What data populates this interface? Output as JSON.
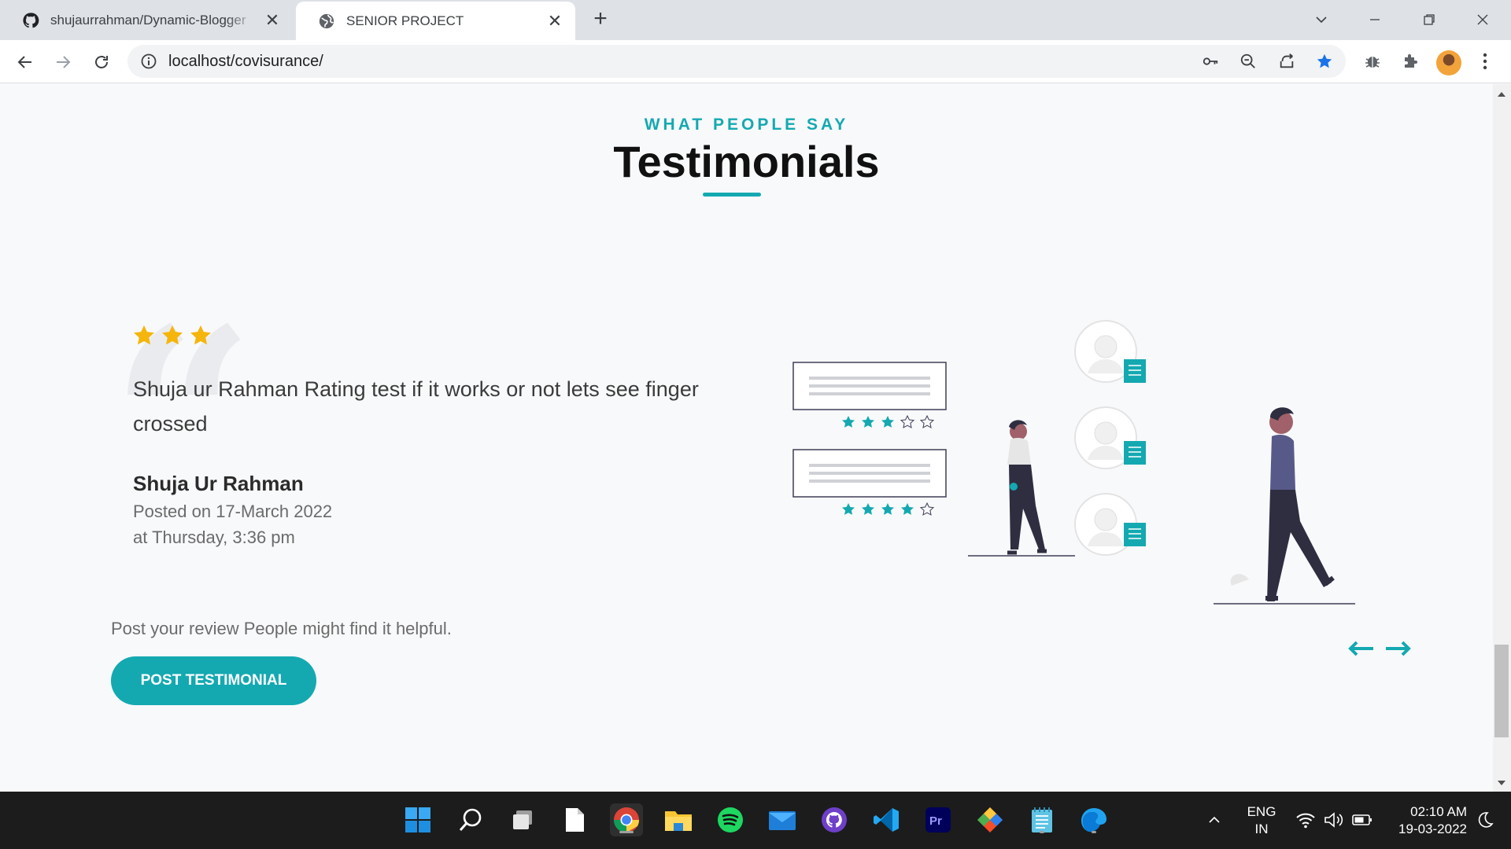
{
  "browser": {
    "tabs": [
      {
        "title": "shujaurrahman/Dynamic-Blogger",
        "icon": "github-icon"
      },
      {
        "title": "SENIOR PROJECT",
        "icon": "globe-icon"
      }
    ],
    "url": "localhost/covisurance/"
  },
  "section": {
    "eyebrow": "WHAT PEOPLE SAY",
    "heading": "Testimonials"
  },
  "testimonial": {
    "rating": 3,
    "text": "Shuja ur Rahman Rating test if it works or not lets see finger crossed",
    "author": "Shuja Ur Rahman",
    "posted_line1": "Posted on 17-March 2022",
    "posted_line2": "at Thursday, 3:36 pm"
  },
  "cta": {
    "prompt": "Post your review People might find it helpful.",
    "button": "POST TESTIMONIAL"
  },
  "illustration": {
    "card_ratings": [
      3,
      4
    ],
    "accent": "#14a9b1"
  },
  "taskbar": {
    "apps": [
      "windows-start-icon",
      "search-icon",
      "task-view-icon",
      "notepad-icon",
      "chrome-icon",
      "file-explorer-icon",
      "spotify-icon",
      "mail-icon",
      "github-desktop-icon",
      "vscode-icon",
      "premiere-pro-icon",
      "git-icon",
      "notepad-plus-icon",
      "edge-icon"
    ],
    "language": "ENG",
    "region": "IN",
    "time": "02:10 AM",
    "date": "19-03-2022"
  },
  "colors": {
    "accent": "#14a9b1",
    "star": "#f5b50a"
  }
}
